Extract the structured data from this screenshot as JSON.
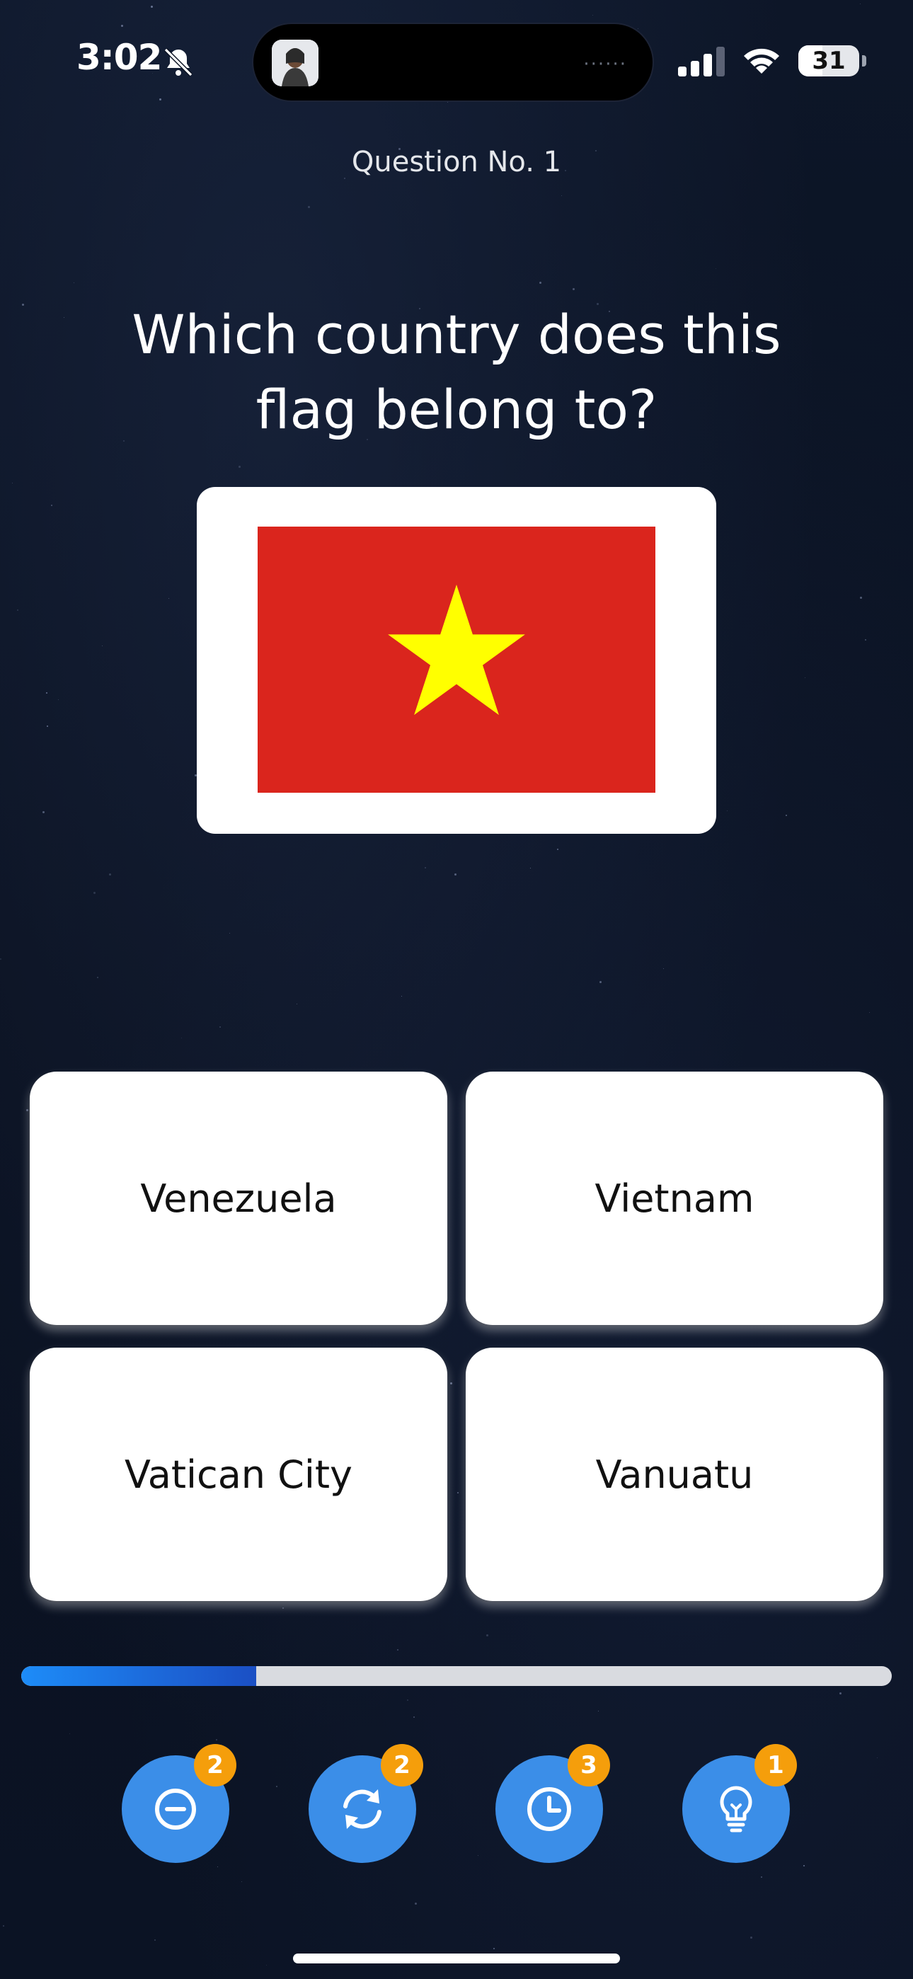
{
  "status_bar": {
    "time": "3:02",
    "battery": "31",
    "island_dots": "······"
  },
  "quiz": {
    "question_number": "Question No. 1",
    "question": "Which country does this flag belong to?",
    "flag_icon": "vietnam-flag",
    "flag_colors": {
      "field": "#da251d",
      "star": "#ffff00"
    },
    "answers": [
      {
        "label": "Venezuela"
      },
      {
        "label": "Vietnam"
      },
      {
        "label": "Vatican City"
      },
      {
        "label": "Vanuatu"
      }
    ],
    "progress": 0.27
  },
  "lifelines": [
    {
      "icon": "minus-circle-icon",
      "count": "2"
    },
    {
      "icon": "refresh-icon",
      "count": "2"
    },
    {
      "icon": "clock-icon",
      "count": "3"
    },
    {
      "icon": "lightbulb-icon",
      "count": "1"
    }
  ],
  "colors": {
    "accent": "#3b8ee8",
    "badge": "#f59e0b",
    "progress_start": "#1d8cf8",
    "progress_end": "#1b4fc4"
  }
}
